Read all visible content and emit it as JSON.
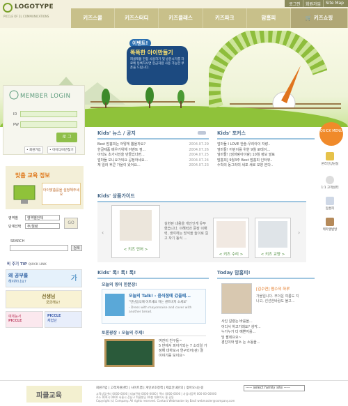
{
  "header": {
    "logo": "LOGOTYPE",
    "logo_sub": "PICCLE OF 2L COMMUNICATIONS",
    "util": [
      "로그인",
      "회원가입",
      "Site Map"
    ],
    "gnb": [
      "키즈스쿨",
      "키즈스터디",
      "키즈클래스",
      "키즈파크",
      "맘홈피",
      "키즈쇼핑"
    ]
  },
  "hero": {
    "event": "이벤트!",
    "title": "똑똑한 아이만들기",
    "desc": "피클제품 전집 사용하기 및 방문시기를 자료에 등록하시면 현금처럼 사용 가능한 쿠폰을 드립니다."
  },
  "login": {
    "title": "MEMBER LOGIN",
    "id_label": "ID",
    "pw_label": "PW",
    "button": "로 그",
    "join": "• 회원가입",
    "find": "• 아이디/비번찾기"
  },
  "edu": {
    "title": "맞춤 교육 정보",
    "box": "아이맞춤를을 설정해주세요",
    "select1_label": "영역별",
    "select1_value": "영역별전체",
    "select2_label": "단계선택",
    "select2_value": "주/월령",
    "go": "GO"
  },
  "search": {
    "label": "SEARCH",
    "button": "검색"
  },
  "tip": {
    "title": "비 주기 TIP",
    "sub": "QUICK LINK"
  },
  "banners": [
    {
      "a": "왜 공부를",
      "b": "해야하나요?",
      "c": "가"
    },
    {
      "a": "선생님",
      "b": "궁금해요!"
    },
    {
      "a": "예체능서",
      "b": "PICCLE"
    },
    {
      "a": "PICCLE",
      "b": "체험단"
    }
  ],
  "news": {
    "title": "Kids' 뉴스 / 공지",
    "items": [
      {
        "t": "Best 맘홈피는 어떻게 뽑을까요?",
        "d": "2004.07.29"
      },
      {
        "t": "한글제품 배우기위해 이벤트 점...",
        "d": "2004.07.26"
      },
      {
        "t": "아직도 초가사진을 만들었다면...",
        "d": "2004.07.25"
      },
      {
        "t": "엄마들 모니요가되요 공정하세요...",
        "d": "2004.07.24"
      },
      {
        "t": "재 일러 후쿤 가을이 왔어요...",
        "d": "2004.07.23"
      }
    ]
  },
  "focus": {
    "title": "Kids' 포커스",
    "items": [
      "엄마들 I LOVE 한솔-우리아이 자랑..",
      "엄마들! 어린이를 위한 9월 로테이…",
      "엄마들! [엄마랑아이랑] 10월 정보 발표",
      "맘홈피] 9월3주 Best 맘홈피 인터뷰..",
      "수학의 동그라미 세포 새로 모양 본다.."
    ]
  },
  "guide": {
    "title": "Kids' 상품가이드",
    "items": [
      "< 키즈 언어 >",
      "< 키즈 수리 >",
      "< 키즈 교양 >"
    ],
    "desc": "실현된 내용을 개인인게 유무했습니다. 이해력과 문장 이해력, 생각하는 방식을 놀이로 걸고 자기 동식 ..."
  },
  "talk": {
    "title": "Kids' 톡! 톡! 톡!",
    "today_q": "오늘의 영어 한문장!",
    "today_main": "오늘의 Talk! - 음식점에 갔을때...",
    "today_quote": "\"만난음식에 어르세요 하는 센트비지 소세요\"",
    "today_en": "- Dress with mayonnaise and cover with another bread.",
    "debate": "토론광장 : 오늘의 주제!",
    "debate_items": [
      "여전이 친구들~",
      "5 반에서 피아가되는 7 소리일 가정해 대하보시 연구되어(관) 결 이야기를 보이요~"
    ]
  },
  "momhome": {
    "title": "Today 맘홈피!",
    "head": "[김수연] 쩜수의 하루",
    "body": "가을입니다. 무더운 여름도 지나고, 선선한바람도 불고...",
    "items": [
      "사진 갈렸는 바를을...",
      "어디서 하고기래요? 생각...",
      "누가누가 더 예쁜지를...",
      "딩 팔네요요~",
      "경진이와 맘소 는 소동을..."
    ]
  },
  "quick": {
    "title": "QUICK MENU",
    "items": [
      "온라인상담실",
      "1:1 고객센터",
      "맘홈피",
      "테마앨범방"
    ]
  },
  "footer": {
    "logo": "피클교육",
    "links": [
      "회원가입",
      "고객지원센터",
      "사이트맵",
      "개인보호정책",
      "제휴안내문의",
      "찾아오시는길"
    ],
    "addr1": "고객상담센터 0000-0000 | 대표전화 0000-0000 | 팩스 0000-0000 | 사업자등록 000-00-00000",
    "addr2": "주소 000시 0000 서울시 강남구 피클빌딩 00층 대표이사 홍 길동",
    "copy": "Copyright (c) Company. All rights reserved. Contact Webmaster by Basil webmaster@company.com",
    "family": "----- select family site -----"
  }
}
